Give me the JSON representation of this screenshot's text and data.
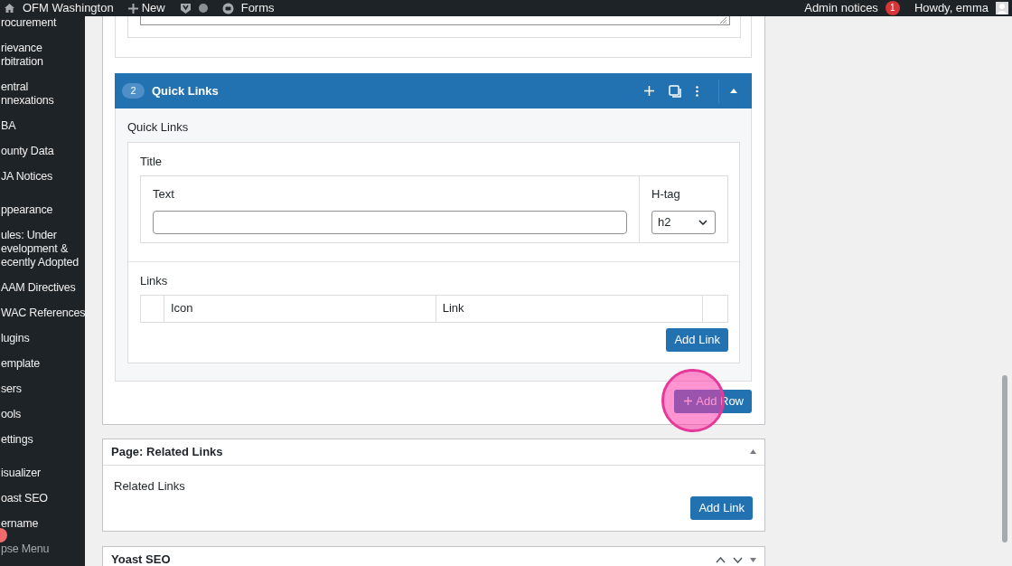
{
  "admin_bar": {
    "site": "OFM Washington",
    "new": "New",
    "forms": "Forms",
    "notices": "Admin notices",
    "notice_count": "1",
    "greeting": "Howdy, emma"
  },
  "sidebar": {
    "groups": [
      [
        {
          "lines": [
            "rocurement"
          ]
        },
        {
          "lines": [
            "rievance",
            "rbitration"
          ]
        },
        {
          "lines": [
            "entral",
            "nnexations"
          ]
        },
        {
          "lines": [
            "BA"
          ]
        },
        {
          "lines": [
            "ounty Data"
          ]
        },
        {
          "lines": [
            "JA Notices"
          ]
        }
      ],
      [
        {
          "lines": [
            "ppearance"
          ]
        },
        {
          "lines": [
            "ules: Under",
            "evelopment &",
            "ecently Adopted"
          ]
        },
        {
          "lines": [
            "AAM Directives"
          ]
        },
        {
          "lines": [
            "WAC References"
          ]
        },
        {
          "lines": [
            "lugins"
          ]
        },
        {
          "lines": [
            "emplate"
          ]
        },
        {
          "lines": [
            "sers"
          ]
        },
        {
          "lines": [
            "ools"
          ]
        },
        {
          "lines": [
            "ettings"
          ]
        }
      ],
      [
        {
          "lines": [
            "isualizer"
          ]
        },
        {
          "lines": [
            "oast SEO"
          ]
        },
        {
          "lines": [
            "ername"
          ]
        },
        {
          "lines": [
            "pse Menu"
          ],
          "kind": "collapse"
        }
      ]
    ]
  },
  "layout": {
    "row_number": "2",
    "title": "Quick Links",
    "expanded": true,
    "field_label": "Quick Links",
    "group_label": "Title",
    "text_label": "Text",
    "htag_label": "H-tag",
    "htag_value": "h2",
    "links_label": "Links",
    "columns": [
      "Icon",
      "Link"
    ],
    "add_link": "Add Link"
  },
  "add_row": "Add Row",
  "related_links_box": {
    "title": "Page: Related Links",
    "label": "Related Links",
    "button": "Add Link"
  },
  "yoast_box": {
    "title": "Yoast SEO"
  }
}
